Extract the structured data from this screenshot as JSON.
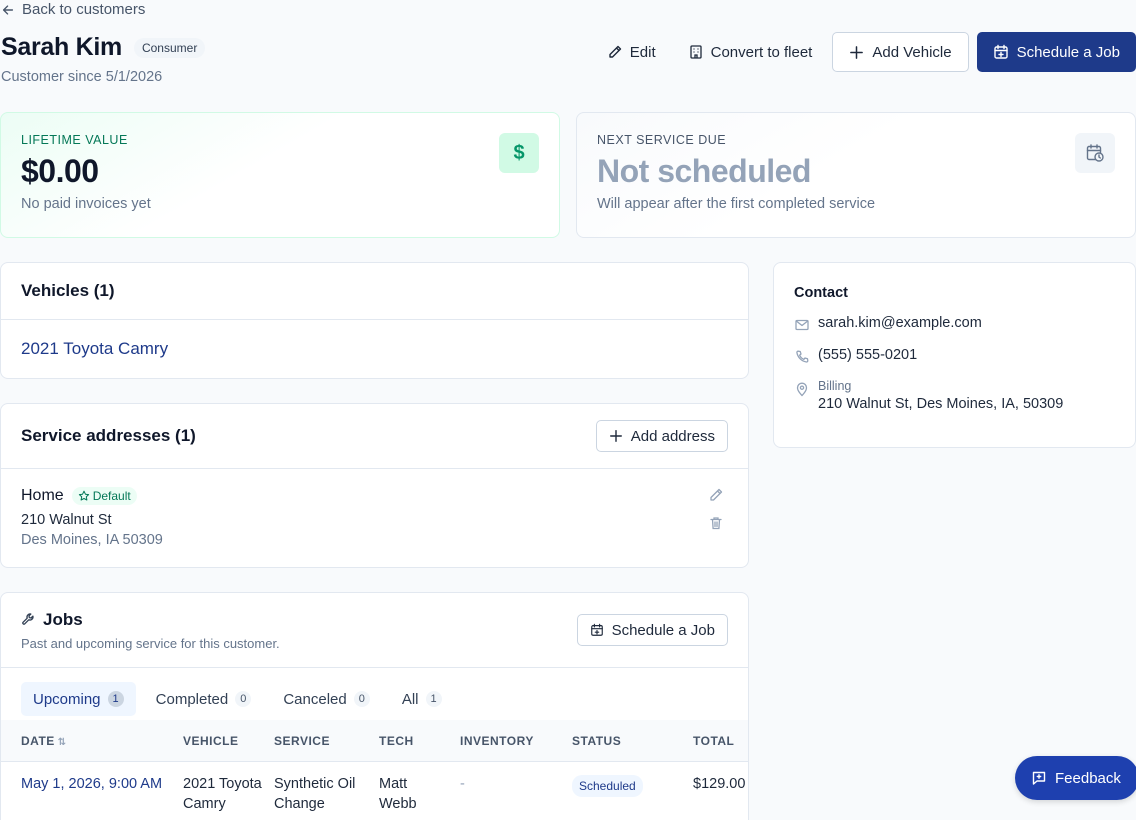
{
  "nav": {
    "back_label": "Back to customers"
  },
  "customer": {
    "name": "Sarah Kim",
    "type_badge": "Consumer",
    "since_text": "Customer since 5/1/2026"
  },
  "header_actions": {
    "edit_label": "Edit",
    "convert_label": "Convert to fleet",
    "add_vehicle_label": "Add Vehicle",
    "schedule_label": "Schedule a Job"
  },
  "stats": {
    "lifetime": {
      "label": "LIFETIME VALUE",
      "value": "$0.00",
      "sub": "No paid invoices yet",
      "icon": "$"
    },
    "next_service": {
      "label": "NEXT SERVICE DUE",
      "value": "Not scheduled",
      "sub": "Will appear after the first completed service"
    }
  },
  "vehicles": {
    "title": "Vehicles (1)",
    "items": [
      {
        "label": "2021 Toyota Camry"
      }
    ]
  },
  "addresses": {
    "title": "Service addresses (1)",
    "add_label": "Add address",
    "items": [
      {
        "name": "Home",
        "badge": "Default",
        "line1": "210 Walnut St",
        "line2": "Des Moines, IA 50309"
      }
    ]
  },
  "jobs": {
    "title": "Jobs",
    "subtitle": "Past and upcoming service for this customer.",
    "schedule_label": "Schedule a Job",
    "tabs": [
      {
        "label": "Upcoming",
        "count": "1"
      },
      {
        "label": "Completed",
        "count": "0"
      },
      {
        "label": "Canceled",
        "count": "0"
      },
      {
        "label": "All",
        "count": "1"
      }
    ],
    "columns": [
      "DATE",
      "VEHICLE",
      "SERVICE",
      "TECH",
      "INVENTORY",
      "STATUS",
      "TOTAL"
    ],
    "sort_glyph": "⇅",
    "rows": [
      {
        "date": "May 1, 2026, 9:00 AM",
        "vehicle": "2021 Toyota Camry",
        "service": "Synthetic Oil Change",
        "tech": "Matt Webb",
        "inventory": "-",
        "status": "Scheduled",
        "total": "$129.00"
      }
    ]
  },
  "contact": {
    "title": "Contact",
    "email": "sarah.kim@example.com",
    "phone": "(555) 555-0201",
    "billing_label": "Billing",
    "billing_address": "210 Walnut St, Des Moines, IA, 50309"
  },
  "feedback_label": "Feedback",
  "colors": {
    "primary": "#1e3a8a",
    "success": "#059669",
    "muted": "#64748b"
  }
}
